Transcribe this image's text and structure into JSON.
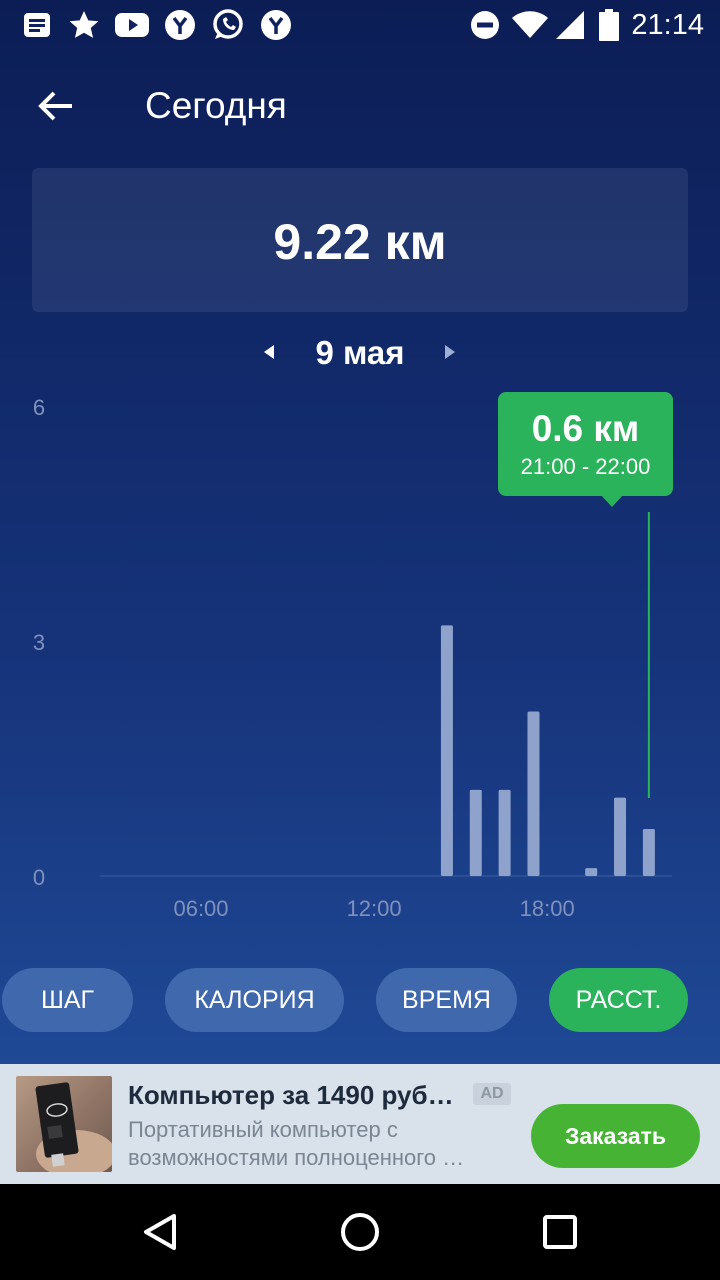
{
  "status_bar": {
    "time": "21:14",
    "left_icons": [
      "message-icon",
      "star-icon",
      "youtube-icon",
      "yandex-icon",
      "whatsapp-icon",
      "yandex-icon"
    ],
    "right_icons": [
      "do-not-disturb-icon",
      "wifi-icon",
      "signal-icon",
      "battery-icon"
    ]
  },
  "app_bar": {
    "title": "Сегодня"
  },
  "summary": {
    "value": "9.22 км"
  },
  "date_nav": {
    "label": "9 мая"
  },
  "tooltip": {
    "value": "0.6 км",
    "range": "21:00 - 22:00"
  },
  "chart_data": {
    "type": "bar",
    "x_unit": "hour",
    "xlim": [
      0,
      24
    ],
    "ylim": [
      0,
      6
    ],
    "y_ticks": [
      "6",
      "3",
      "0"
    ],
    "x_ticks": [
      "06:00",
      "12:00",
      "18:00"
    ],
    "x_tick_hours": [
      6,
      12,
      18
    ],
    "hours": [
      15,
      16,
      17,
      18,
      20,
      21,
      22
    ],
    "values": [
      3.2,
      1.1,
      1.1,
      2.1,
      0.1,
      1.0,
      0.6
    ],
    "selected_hour": 22,
    "colors": {
      "bar": "#8ea2cc",
      "selected_line": "#2bb35c",
      "axis_text": "#8091bd"
    }
  },
  "tabs": [
    {
      "label": "ШАГ",
      "active": false
    },
    {
      "label": "КАЛОРИЯ",
      "active": false
    },
    {
      "label": "ВРЕМЯ",
      "active": false
    },
    {
      "label": "РАССТ.",
      "active": true
    }
  ],
  "ad": {
    "title": "Компьютер за 1490 руб…",
    "badge": "AD",
    "description_line1": "Портативный компьютер с",
    "description_line2": "возможностями полноценного …",
    "cta": "Заказать"
  },
  "colors": {
    "accent": "#2bb35c",
    "tab_inactive": "#4068ad",
    "ad_cta": "#47b335"
  }
}
